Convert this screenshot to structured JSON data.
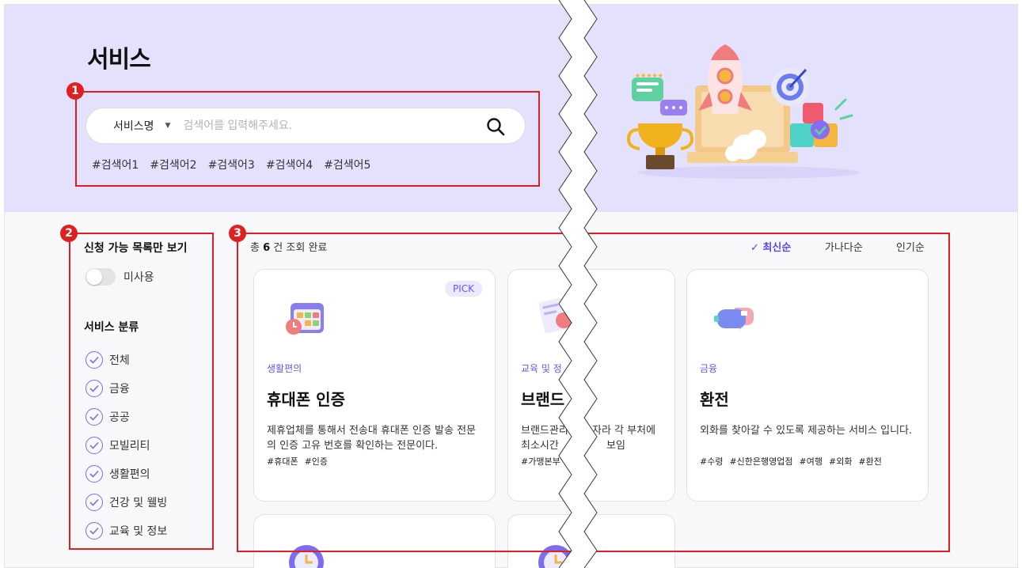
{
  "page": {
    "title": "서비스"
  },
  "search": {
    "select_label": "서비스명",
    "placeholder": "검색어를 입력해주세요.",
    "hashtags": [
      "#검색어1",
      "#검색어2",
      "#검색어3",
      "#검색어4",
      "#검색어5"
    ]
  },
  "callouts": [
    "1",
    "2",
    "3"
  ],
  "sidebar": {
    "filter_title": "신청 가능 목록만 보기",
    "toggle_label": "미사용",
    "category_title": "서비스 분류",
    "categories": [
      "전체",
      "금융",
      "공공",
      "모빌리티",
      "생활편의",
      "건강 및 웰빙",
      "교육 및 정보"
    ]
  },
  "results": {
    "prefix": "총",
    "count": "6",
    "suffix": "건 조회 완료",
    "sort_options": [
      "최신순",
      "가나다순",
      "인기순"
    ],
    "active_sort": "최신순"
  },
  "cards": [
    {
      "badge": "PICK",
      "category": "생활편의",
      "title": "휴대폰 인증",
      "description": "제휴업체를 통해서 전송대 휴대폰 인증 발송 전문의 인증 고유 번호를 확인하는 전문이다.",
      "tags": [
        "#휴대폰",
        "#인증"
      ]
    },
    {
      "category": "교육 및 정",
      "title": "브랜드",
      "description_lines": [
        "브랜드관리",
        "자라 각 부처에",
        "최소시간",
        "보임"
      ],
      "tags": [
        "#가맹본부"
      ]
    },
    {
      "category": "금융",
      "title": "환전",
      "description": "외화를 찾아갈 수 있도록 제공하는 서비스 입니다.",
      "tags": [
        "#수령",
        "#신한은행영업점",
        "#여행",
        "#외화",
        "#환전"
      ]
    }
  ],
  "colors": {
    "accent": "#5b45e6",
    "hero_bg": "#e4e1fd",
    "callout_red": "#e02020"
  }
}
